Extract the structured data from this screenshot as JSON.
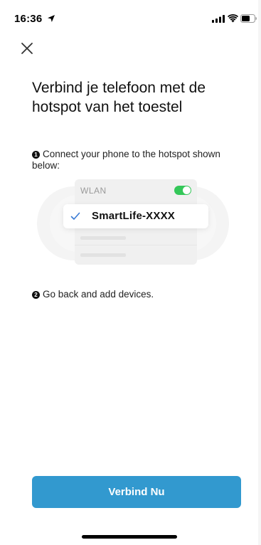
{
  "status_bar": {
    "time": "16:36",
    "icons": [
      "location-arrow-icon",
      "cellular-signal-icon",
      "wifi-icon",
      "battery-icon"
    ]
  },
  "header": {
    "close_icon": "close-icon"
  },
  "main": {
    "title": "Verbind je telefoon met de hotspot van het toestel",
    "step1": {
      "bullet": "1",
      "text": "Connect your phone to the hotspot shown below:"
    },
    "illustration": {
      "wlan_label": "WLAN",
      "network_name": "SmartLife-XXXX",
      "toggle_color": "#34c759",
      "check_color": "#3a7bd5"
    },
    "step2": {
      "bullet": "2",
      "text": "Go back and add devices."
    }
  },
  "footer": {
    "connect_label": "Verbind Nu",
    "accent_color": "#3299cf"
  }
}
